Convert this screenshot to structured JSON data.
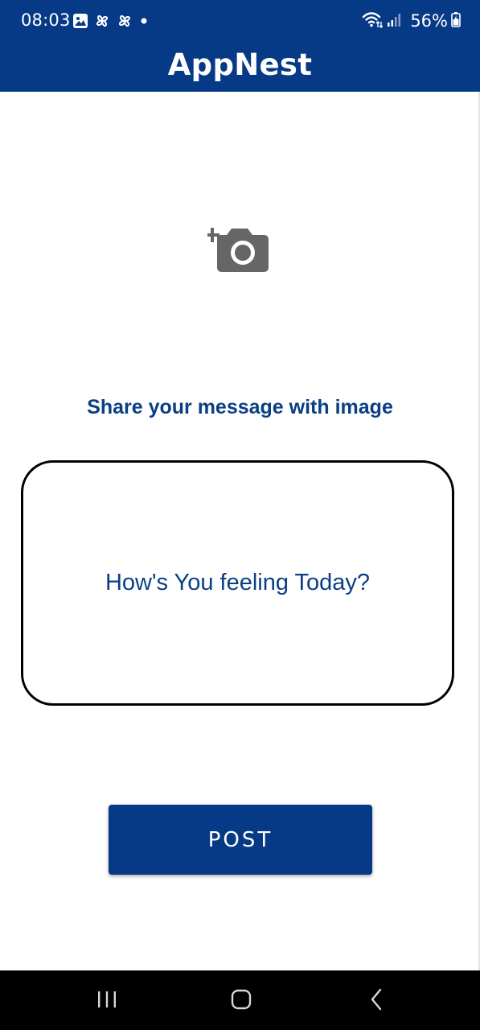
{
  "status_bar": {
    "time": "08:03",
    "battery": "56%",
    "icons": [
      "gallery-icon",
      "pinwheel-icon",
      "pinwheel-icon",
      "notification-dot-icon",
      "wifi-icon",
      "signal-icon",
      "battery-icon"
    ]
  },
  "header": {
    "title": "AppNest",
    "background_color": "#063a87"
  },
  "main": {
    "camera_icon": "add-photo-icon",
    "share_label": "Share your message with image",
    "message_placeholder": "How's You feeling Today?",
    "message_value": "",
    "post_label": "POST",
    "accent_color": "#0a3f85"
  },
  "nav_bar": {
    "icons": [
      "recent-apps-icon",
      "home-icon",
      "back-icon"
    ]
  }
}
